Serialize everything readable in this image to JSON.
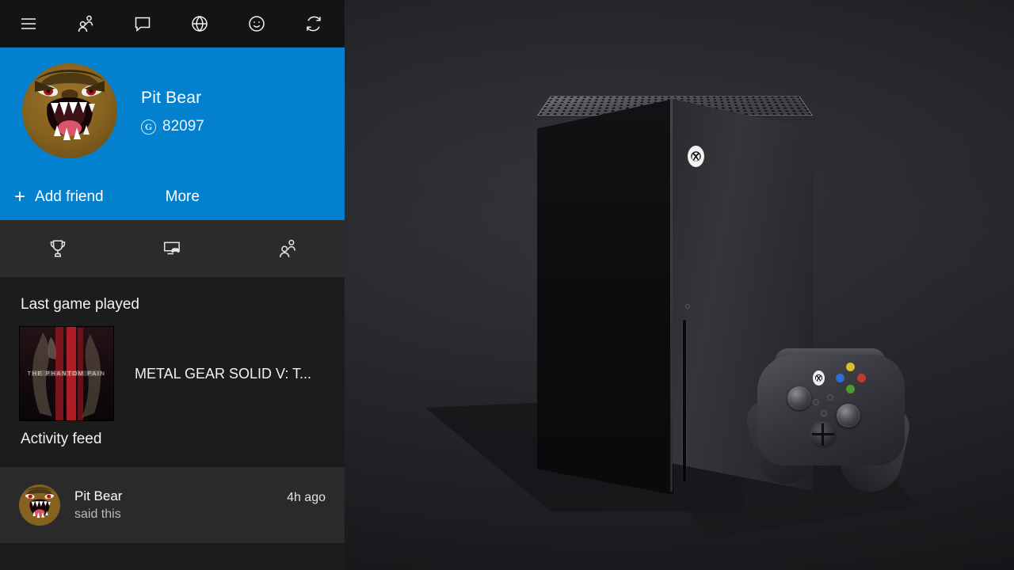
{
  "wallpaper": {
    "name": "xbox-series-x-console-and-controller",
    "background_color": "#232327",
    "console_label": "Xbox Series X",
    "controller_label": "Xbox Wireless Controller"
  },
  "topbar": {
    "icons": [
      {
        "name": "hamburger-menu-icon",
        "label": "Menu"
      },
      {
        "name": "friends-icon",
        "label": "Friends"
      },
      {
        "name": "message-icon",
        "label": "Messages"
      },
      {
        "name": "globe-icon",
        "label": "Feed"
      },
      {
        "name": "smiley-icon",
        "label": "Emoji"
      },
      {
        "name": "refresh-icon",
        "label": "Refresh"
      }
    ]
  },
  "profile": {
    "accent_color": "#0481ce",
    "gamertag": "Pit Bear",
    "gamerscore": "82097",
    "gamerscore_icon": "gamerscore-g-icon",
    "avatar_name": "roaring-bear-avatar",
    "add_friend_label": "Add friend",
    "add_friend_plus": "+",
    "more_label": "More"
  },
  "tabs": [
    {
      "name": "tab-achievements",
      "icon": "trophy-icon"
    },
    {
      "name": "tab-captures",
      "icon": "screen-controller-icon"
    },
    {
      "name": "tab-friends",
      "icon": "friends-icon"
    }
  ],
  "content": {
    "last_game_heading": "Last game played",
    "last_game": {
      "title": "METAL GEAR SOLID V: T...",
      "art_name": "metal-gear-solid-v-phantom-pain-boxart",
      "art_caption": "THE PHANTOM PAIN"
    },
    "activity_heading": "Activity feed",
    "activity_items": [
      {
        "name": "Pit Bear",
        "action": "said this",
        "time": "4h ago",
        "avatar_name": "roaring-bear-avatar"
      }
    ]
  }
}
